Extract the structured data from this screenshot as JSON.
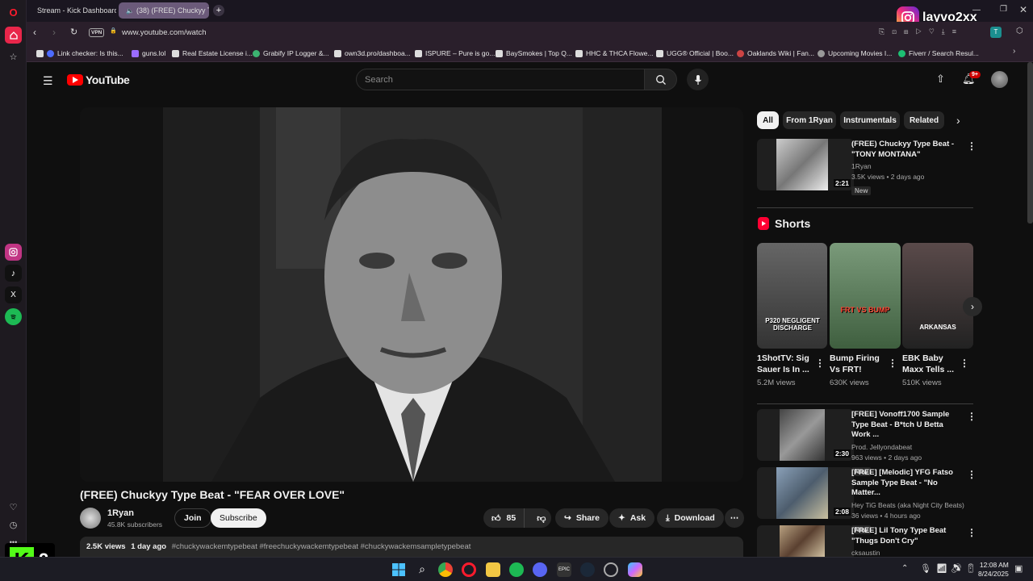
{
  "browser": {
    "tabs": [
      {
        "title": "Stream - Kick Dashboard",
        "active": false
      },
      {
        "title": "(38) (FREE) Chuckyy T",
        "active": true
      }
    ],
    "new_tab_label": "+",
    "url": "www.youtube.com/watch",
    "vpn_label": "VPN",
    "profile_overlay": "layvo2xx",
    "extension_badge": "T"
  },
  "bookmarks": [
    "Link checker: Is this...",
    "guns.lol",
    "Real Estate License i...",
    "Grabify IP Logger &...",
    "own3d.pro/dashboa...",
    "ISPURE – Pure is go...",
    "BaySmokes | Top Q...",
    "HHC & THCA Flowe...",
    "UGG® Official | Boo...",
    "Oaklands Wiki | Fan...",
    "Upcoming Movies I...",
    "Fiverr / Search Resul..."
  ],
  "youtube": {
    "logo_text": "YouTube",
    "search_placeholder": "Search",
    "notif_count": "9+",
    "video": {
      "title": "(FREE) Chuckyy Type Beat - \"FEAR OVER LOVE\"",
      "channel": "1Ryan",
      "subscribers": "45.8K subscribers",
      "join_label": "Join",
      "subscribe_label": "Subscribe",
      "likes": "85",
      "share_label": "Share",
      "ask_label": "Ask",
      "download_label": "Download",
      "views": "2.5K views",
      "age": "1 day ago",
      "hashtags": "#chuckywackemtypebeat #freechuckywackemtypebeat #chuckywackemsampletypebeat"
    },
    "chips": [
      "All",
      "From 1Ryan",
      "Instrumentals",
      "Related"
    ],
    "shorts_heading": "Shorts",
    "shorts": [
      {
        "title": "1ShotTV: Sig Sauer Is In ...",
        "views": "5.2M views",
        "overlay": "P320 NEGLIGENT DISCHARGE"
      },
      {
        "title": "Bump Firing Vs FRT!",
        "views": "630K views",
        "overlay": "FRT VS BUMP"
      },
      {
        "title": "EBK Baby Maxx Tells ...",
        "views": "510K views",
        "overlay": "ARKANSAS"
      }
    ],
    "recommended": [
      {
        "title": "(FREE) Chuckyy Type Beat - \"TONY MONTANA\"",
        "channel": "1Ryan",
        "meta": "3.5K views • 2 days ago",
        "badge": "New",
        "duration": "2:21"
      },
      {
        "title": "[FREE] Vonoff1700 Sample Type Beat - B*tch U Betta Work ...",
        "channel": "Prod. Jellyondabeat",
        "meta": "963 views • 2 days ago",
        "badge": "New",
        "duration": "2:30"
      },
      {
        "title": "[FREE] [Melodic] YFG Fatso Sample Type Beat - \"No Matter...",
        "channel": "Hey TiG Beats (aka Night City Beats)",
        "meta": "36 views • 4 hours ago",
        "badge": "New",
        "duration": "2:08"
      },
      {
        "title": "[FREE] Lil Tony Type Beat \"Thugs Don't Cry\"",
        "channel": "cksaustin",
        "meta": "",
        "badge": "",
        "duration": ""
      }
    ]
  },
  "kick_overlay": "2",
  "taskbar": {
    "time": "12:08 AM",
    "date": "8/24/2025"
  }
}
